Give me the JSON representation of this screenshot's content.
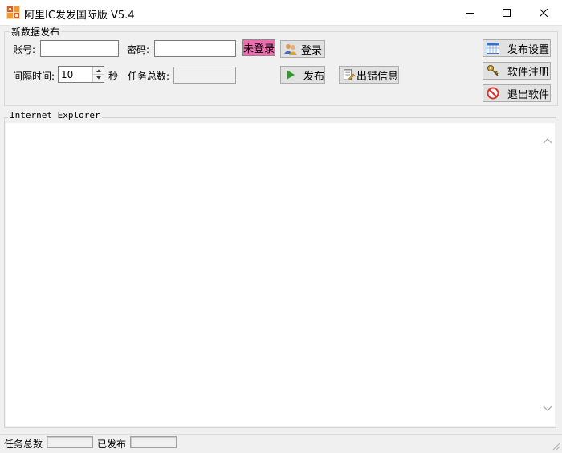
{
  "window": {
    "title": "阿里IC发发国际版 V5.4",
    "minimize_glyph": "—",
    "maximize_glyph": "☐",
    "close_glyph": "✕"
  },
  "publish_group": {
    "label": "新数据发布",
    "account_label": "账号:",
    "account_value": "",
    "password_label": "密码:",
    "password_value": "",
    "login_status": "未登录",
    "login_button": "登录",
    "interval_label": "间隔时间:",
    "interval_value": "10",
    "interval_unit": "秒",
    "task_total_label": "任务总数:",
    "task_total_value": "",
    "publish_button": "发布",
    "error_info_button": "出错信息"
  },
  "side_buttons": {
    "publish_settings": "发布设置",
    "software_register": "软件注册",
    "exit_software": "退出软件"
  },
  "browser": {
    "label": "Internet Explorer"
  },
  "statusbar": {
    "task_total_label": "任务总数",
    "task_total_value": "",
    "published_label": "已发布",
    "published_value": ""
  },
  "colors": {
    "login_status_bg": "#ea6fb0",
    "publish_arrow": "#2e9a2e",
    "exit_icon": "#d9302a"
  },
  "icons": {
    "app": "app-logo-icon",
    "login": "users-icon",
    "publish": "play-arrow-icon",
    "error_info": "document-edit-icon",
    "settings": "calendar-grid-icon",
    "register": "key-icon",
    "exit": "no-entry-icon"
  }
}
